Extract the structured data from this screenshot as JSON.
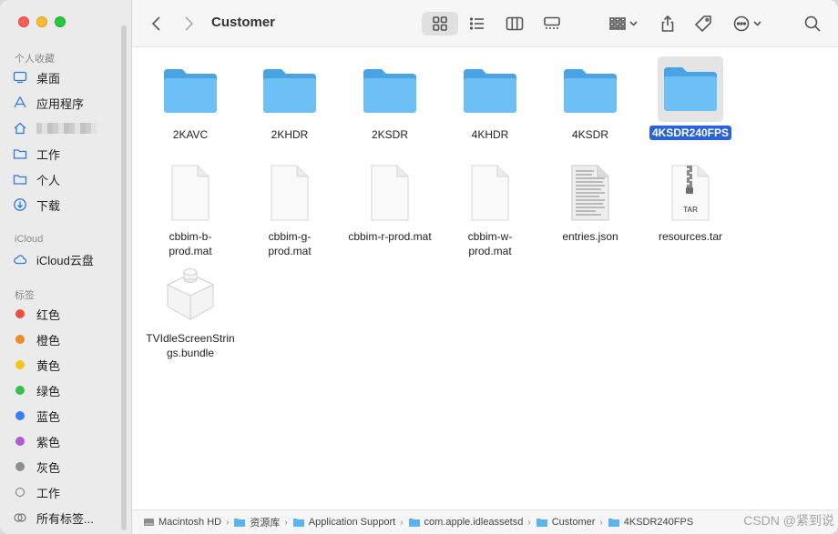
{
  "window": {
    "title": "Customer"
  },
  "sidebar": {
    "sections": {
      "favorites": "个人收藏",
      "icloud": "iCloud",
      "tags": "标签"
    },
    "favorites": [
      {
        "label": "桌面",
        "icon": "desktop-icon"
      },
      {
        "label": "应用程序",
        "icon": "applications-icon"
      },
      {
        "label": "",
        "icon": "home-icon",
        "obscured": true
      },
      {
        "label": "工作",
        "icon": "folder-icon"
      },
      {
        "label": "个人",
        "icon": "folder-icon"
      },
      {
        "label": "下载",
        "icon": "downloads-icon"
      }
    ],
    "icloud_items": [
      {
        "label": "iCloud云盘",
        "icon": "cloud-icon"
      }
    ],
    "tags": [
      {
        "label": "红色",
        "color": "#ef4b3f"
      },
      {
        "label": "橙色",
        "color": "#f08a24"
      },
      {
        "label": "黄色",
        "color": "#f5c518"
      },
      {
        "label": "绿色",
        "color": "#35c04a"
      },
      {
        "label": "蓝色",
        "color": "#3a7ff5"
      },
      {
        "label": "紫色",
        "color": "#b05bd6"
      },
      {
        "label": "灰色",
        "color": "#8e8e93"
      },
      {
        "label": "工作",
        "color": ""
      },
      {
        "label": "所有标签...",
        "color": ""
      }
    ]
  },
  "toolbar": {
    "back": "chevron-left-icon",
    "forward": "chevron-right-icon",
    "view_modes": [
      "icon-view",
      "list-view",
      "column-view",
      "gallery-view"
    ],
    "selected_view": "icon-view",
    "actions": [
      "group-icon",
      "share-icon",
      "tag-icon",
      "more-icon",
      "search-icon"
    ]
  },
  "files": [
    {
      "name": "2KAVC",
      "type": "folder"
    },
    {
      "name": "2KHDR",
      "type": "folder"
    },
    {
      "name": "2KSDR",
      "type": "folder"
    },
    {
      "name": "4KHDR",
      "type": "folder"
    },
    {
      "name": "4KSDR",
      "type": "folder"
    },
    {
      "name": "4KSDR240FPS",
      "type": "folder",
      "selected": true
    },
    {
      "name": "cbbim-b-prod.mat",
      "type": "document"
    },
    {
      "name": "cbbim-g-prod.mat",
      "type": "document"
    },
    {
      "name": "cbbim-r-prod.mat",
      "type": "document"
    },
    {
      "name": "cbbim-w-prod.mat",
      "type": "document"
    },
    {
      "name": "entries.json",
      "type": "json"
    },
    {
      "name": "resources.tar",
      "type": "tar",
      "badge": "TAR"
    },
    {
      "name": "TVIdleScreenStrings.bundle",
      "type": "bundle"
    }
  ],
  "pathbar": [
    {
      "label": "Macintosh HD",
      "icon": "disk-icon"
    },
    {
      "label": "资源库",
      "icon": "folder-icon"
    },
    {
      "label": "Application Support",
      "icon": "folder-icon"
    },
    {
      "label": "com.apple.idleassetsd",
      "icon": "folder-icon"
    },
    {
      "label": "Customer",
      "icon": "folder-icon"
    },
    {
      "label": "4KSDR240FPS",
      "icon": "folder-icon"
    }
  ],
  "watermark": "CSDN @紧到说",
  "colors": {
    "folder": "#5ab4f0",
    "folder_tab": "#4aa3e3",
    "selection": "#2a62d9"
  }
}
